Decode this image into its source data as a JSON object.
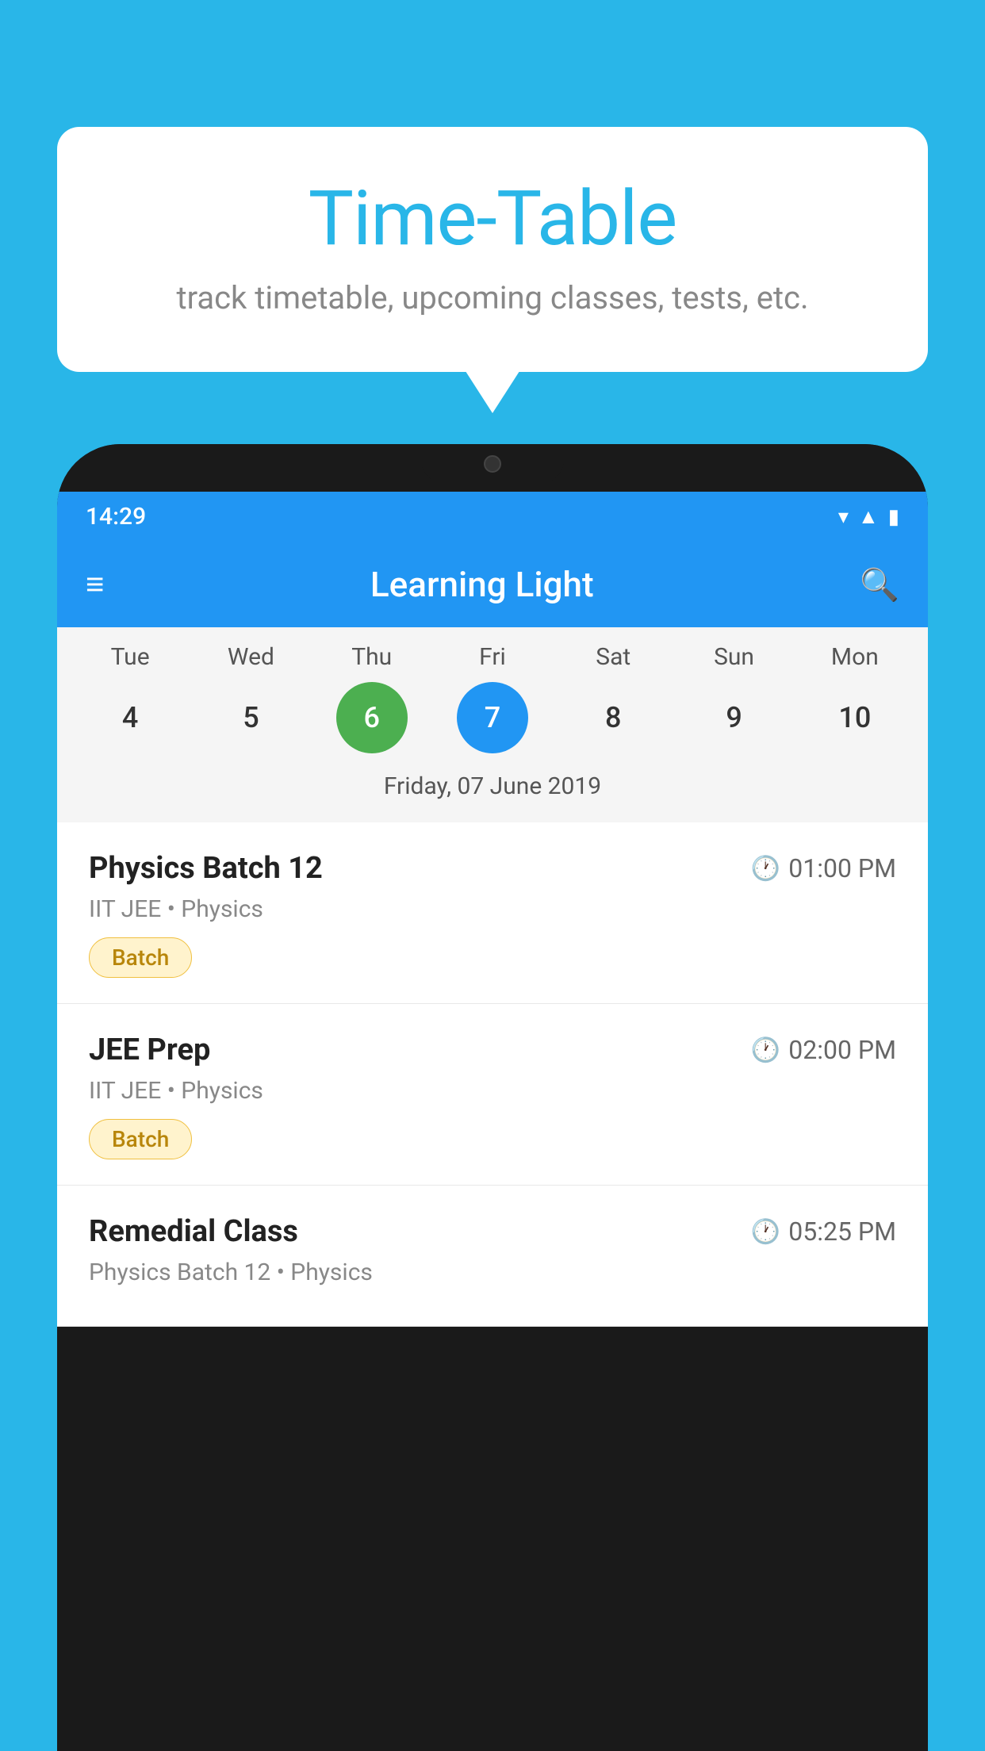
{
  "background_color": "#29B6E8",
  "speech_bubble": {
    "title": "Time-Table",
    "subtitle": "track timetable, upcoming classes, tests, etc."
  },
  "phone": {
    "status_bar": {
      "time": "14:29",
      "icons": [
        "wifi",
        "signal",
        "battery"
      ]
    },
    "header": {
      "title": "Learning Light",
      "menu_icon": "menu",
      "search_icon": "search"
    },
    "calendar": {
      "days": [
        "Tue",
        "Wed",
        "Thu",
        "Fri",
        "Sat",
        "Sun",
        "Mon"
      ],
      "dates": [
        {
          "num": "4",
          "state": "normal"
        },
        {
          "num": "5",
          "state": "normal"
        },
        {
          "num": "6",
          "state": "today"
        },
        {
          "num": "7",
          "state": "selected"
        },
        {
          "num": "8",
          "state": "normal"
        },
        {
          "num": "9",
          "state": "normal"
        },
        {
          "num": "10",
          "state": "normal"
        }
      ],
      "selected_date_label": "Friday, 07 June 2019"
    },
    "classes": [
      {
        "name": "Physics Batch 12",
        "time": "01:00 PM",
        "meta": "IIT JEE • Physics",
        "badge": "Batch"
      },
      {
        "name": "JEE Prep",
        "time": "02:00 PM",
        "meta": "IIT JEE • Physics",
        "badge": "Batch"
      },
      {
        "name": "Remedial Class",
        "time": "05:25 PM",
        "meta": "Physics Batch 12 • Physics",
        "badge": null
      }
    ]
  }
}
